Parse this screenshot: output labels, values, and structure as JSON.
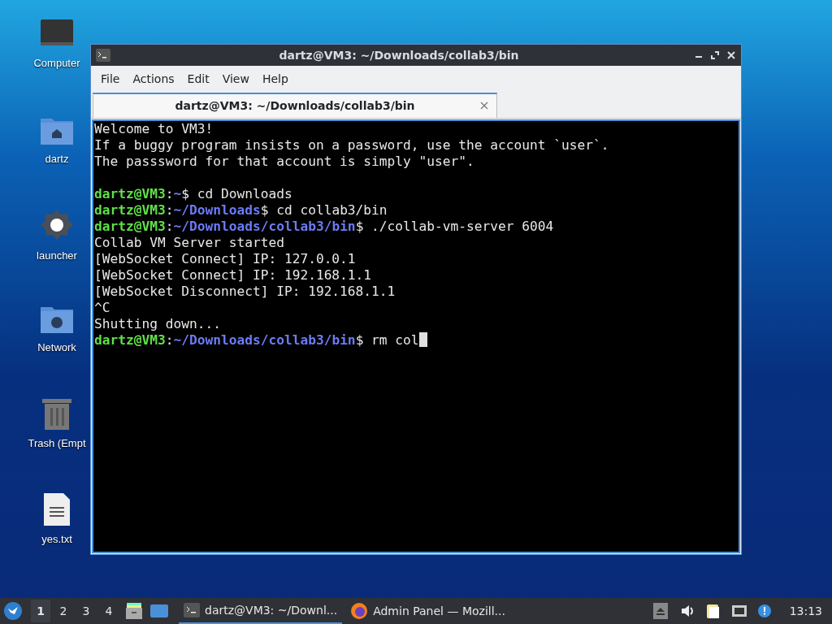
{
  "desktop_icons": [
    {
      "kind": "computer",
      "label": "Computer"
    },
    {
      "kind": "home",
      "label": "dartz"
    },
    {
      "kind": "gear",
      "label": "launcher"
    },
    {
      "kind": "network",
      "label": "Network"
    },
    {
      "kind": "trash",
      "label": "Trash (Empt"
    },
    {
      "kind": "file",
      "label": "yes.txt"
    }
  ],
  "window": {
    "title": "dartz@VM3: ~/Downloads/collab3/bin",
    "menu": [
      "File",
      "Actions",
      "Edit",
      "View",
      "Help"
    ],
    "tabs": [
      {
        "label": "dartz@VM3: ~/Downloads/collab3/bin",
        "selected": true
      }
    ],
    "terminal": {
      "lines": [
        {
          "kind": "text",
          "segments": [
            {
              "kind": "plain",
              "text": "Welcome to VM3!"
            }
          ]
        },
        {
          "kind": "text",
          "segments": [
            {
              "kind": "plain",
              "text": "If a buggy program insists on a password, use the account `user`."
            }
          ]
        },
        {
          "kind": "text",
          "segments": [
            {
              "kind": "plain",
              "text": "The passsword for that account is simply \"user\"."
            }
          ]
        },
        {
          "kind": "blank"
        },
        {
          "kind": "text",
          "segments": [
            {
              "kind": "user",
              "text": "dartz@VM3"
            },
            {
              "kind": "plain",
              "text": ":"
            },
            {
              "kind": "path",
              "text": "~"
            },
            {
              "kind": "plain",
              "text": "$ cd Downloads"
            }
          ]
        },
        {
          "kind": "text",
          "segments": [
            {
              "kind": "user",
              "text": "dartz@VM3"
            },
            {
              "kind": "plain",
              "text": ":"
            },
            {
              "kind": "path",
              "text": "~/Downloads"
            },
            {
              "kind": "plain",
              "text": "$ cd collab3/bin"
            }
          ]
        },
        {
          "kind": "text",
          "segments": [
            {
              "kind": "user",
              "text": "dartz@VM3"
            },
            {
              "kind": "plain",
              "text": ":"
            },
            {
              "kind": "path",
              "text": "~/Downloads/collab3/bin"
            },
            {
              "kind": "plain",
              "text": "$ ./collab-vm-server 6004"
            }
          ]
        },
        {
          "kind": "text",
          "segments": [
            {
              "kind": "plain",
              "text": "Collab VM Server started"
            }
          ]
        },
        {
          "kind": "text",
          "segments": [
            {
              "kind": "plain",
              "text": "[WebSocket Connect] IP: 127.0.0.1"
            }
          ]
        },
        {
          "kind": "text",
          "segments": [
            {
              "kind": "plain",
              "text": "[WebSocket Connect] IP: 192.168.1.1"
            }
          ]
        },
        {
          "kind": "text",
          "segments": [
            {
              "kind": "plain",
              "text": "[WebSocket Disconnect] IP: 192.168.1.1"
            }
          ]
        },
        {
          "kind": "text",
          "segments": [
            {
              "kind": "plain",
              "text": "^C"
            }
          ]
        },
        {
          "kind": "text",
          "segments": [
            {
              "kind": "plain",
              "text": "Shutting down..."
            }
          ]
        },
        {
          "kind": "text",
          "segments": [
            {
              "kind": "user",
              "text": "dartz@VM3"
            },
            {
              "kind": "plain",
              "text": ":"
            },
            {
              "kind": "path",
              "text": "~/Downloads/collab3/bin"
            },
            {
              "kind": "plain",
              "text": "$ rm col"
            }
          ],
          "cursor": true
        }
      ]
    }
  },
  "taskbar": {
    "workspaces": [
      {
        "label": "1",
        "selected": true
      },
      {
        "label": "2",
        "selected": false
      },
      {
        "label": "3",
        "selected": false
      },
      {
        "label": "4",
        "selected": false
      }
    ],
    "tasks": [
      {
        "kind": "terminal",
        "label": "dartz@VM3: ~/Downl...",
        "selected": true
      },
      {
        "kind": "browser",
        "label": "Admin Panel — Mozill...",
        "selected": false
      }
    ],
    "clock": "13:13"
  }
}
